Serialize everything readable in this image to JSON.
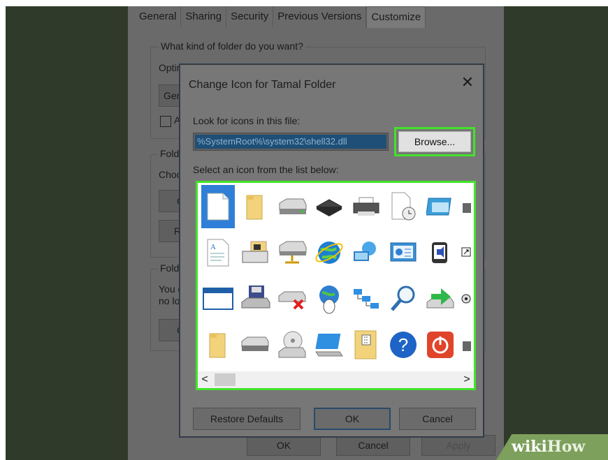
{
  "properties": {
    "tabs": [
      "General",
      "Sharing",
      "Security",
      "Previous Versions",
      "Customize"
    ],
    "active_tab": "Customize",
    "folder_type_heading": "What kind of folder do you want?",
    "optimize_label_partial": "Optim",
    "optimize_value_partial": "Gen",
    "checkbox_label_partial": "A",
    "folder_pictures_partial": "Folde",
    "choose_partial": "Choo",
    "choose_btn_partial": "C",
    "restore_btn_partial": "Re",
    "folder_icons_partial": "Folde",
    "line1_partial": "You c",
    "line2_partial": "no lo",
    "change_btn_partial": "C",
    "bottom_buttons": {
      "ok": "OK",
      "cancel": "Cancel",
      "apply": "Apply"
    }
  },
  "dialog": {
    "title": "Change Icon for Tamal Folder",
    "close_glyph": "✕",
    "look_label": "Look for icons in this file:",
    "file_path": "%SystemRoot%\\system32\\shell32.dll",
    "browse_label": "Browse...",
    "select_label": "Select an icon from the list below:",
    "icons": [
      [
        "blank-document-icon",
        "folder-icon",
        "disk-drive-icon",
        "chip-icon",
        "printer-icon",
        "document-clock-icon",
        "window-icon",
        "partial-icon"
      ],
      [
        "text-document-icon",
        "pc-folder-icon",
        "network-drive-icon",
        "internet-icon",
        "network-globe-icon",
        "control-panel-icon",
        "speaker-icon",
        "shortcut-icon"
      ],
      [
        "application-window-icon",
        "floppy-icon",
        "drive-delete-icon",
        "globe-mouse-icon",
        "network-icon",
        "search-icon",
        "drive-arrow-icon",
        "disc-icon"
      ],
      [
        "folder-icon",
        "drive-icon",
        "cd-drive-icon",
        "monitor-icon",
        "zip-folder-icon",
        "help-icon",
        "power-icon",
        "partial-icon"
      ]
    ],
    "scroll_left": "<",
    "scroll_right": ">",
    "restore_defaults_label": "Restore Defaults",
    "ok_label": "OK",
    "cancel_label": "Cancel"
  },
  "watermark": {
    "wiki": "wiki",
    "how": "How"
  }
}
